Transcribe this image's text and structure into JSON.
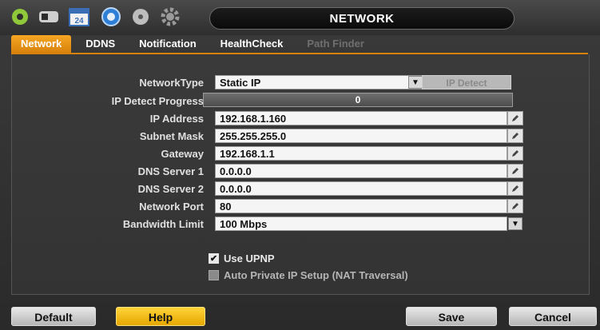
{
  "window": {
    "title": "NETWORK"
  },
  "top_icons": [
    {
      "name": "camera-setup-icon"
    },
    {
      "name": "record-setup-icon"
    },
    {
      "name": "calendar-icon",
      "text": "24"
    },
    {
      "name": "network-icon"
    },
    {
      "name": "device-icon"
    },
    {
      "name": "system-gear-icon"
    }
  ],
  "tabs": [
    {
      "label": "Network",
      "state": "active"
    },
    {
      "label": "DDNS",
      "state": "normal"
    },
    {
      "label": "Notification",
      "state": "normal"
    },
    {
      "label": "HealthCheck",
      "state": "normal"
    },
    {
      "label": "Path Finder",
      "state": "disabled"
    }
  ],
  "form": {
    "network_type": {
      "label": "NetworkType",
      "value": "Static IP"
    },
    "ip_detect_button": "IP Detect",
    "ip_detect_progress": {
      "label": "IP Detect Progress",
      "value": "0"
    },
    "ip_address": {
      "label": "IP Address",
      "value": "192.168.1.160"
    },
    "subnet_mask": {
      "label": "Subnet Mask",
      "value": "255.255.255.0"
    },
    "gateway": {
      "label": "Gateway",
      "value": "192.168.1.1"
    },
    "dns1": {
      "label": "DNS Server 1",
      "value": "0.0.0.0"
    },
    "dns2": {
      "label": "DNS Server 2",
      "value": "0.0.0.0"
    },
    "network_port": {
      "label": "Network Port",
      "value": "80"
    },
    "bandwidth": {
      "label": "Bandwidth Limit",
      "value": "100 Mbps"
    },
    "use_upnp": {
      "label": "Use UPNP",
      "checked": true
    },
    "auto_private_ip": {
      "label": "Auto Private IP Setup (NAT Traversal)",
      "checked": false
    }
  },
  "buttons": {
    "default": "Default",
    "help": "Help",
    "save": "Save",
    "cancel": "Cancel"
  },
  "colors": {
    "accent": "#f5a623",
    "help": "#ffd43a"
  }
}
